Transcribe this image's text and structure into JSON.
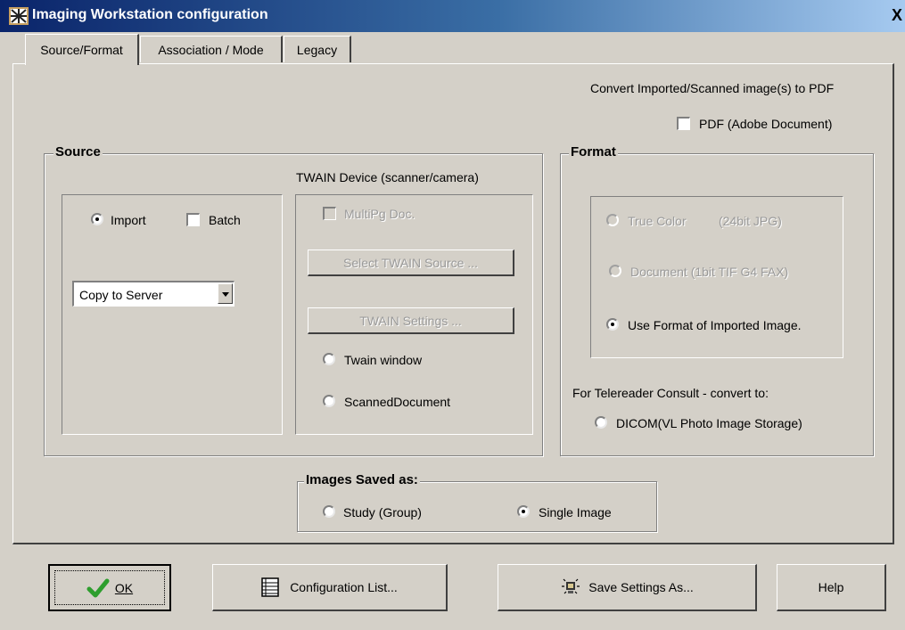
{
  "window": {
    "title": "Imaging Workstation configuration",
    "close_label": "X"
  },
  "tabs": [
    {
      "label": "Source/Format",
      "active": true
    },
    {
      "label": "Association / Mode",
      "active": false
    },
    {
      "label": "Legacy",
      "active": false
    }
  ],
  "pdf": {
    "heading": "Convert Imported/Scanned image(s) to PDF",
    "checkbox_label": "PDF (Adobe Document)",
    "checked": false
  },
  "source": {
    "legend": "Source",
    "import_label": "Import",
    "import_selected": true,
    "batch_label": "Batch",
    "batch_checked": false,
    "combo_value": "Copy to Server"
  },
  "twain": {
    "heading": "TWAIN Device (scanner/camera)",
    "multipage_label": "MultiPg Doc.",
    "select_source_label": "Select TWAIN Source ...",
    "settings_label": "TWAIN Settings ...",
    "twain_window_label": "Twain window",
    "scanned_document_label": "ScannedDocument"
  },
  "format": {
    "legend": "Format",
    "true_color_label": "True Color",
    "true_color_detail": "(24bit JPG)",
    "document_label": "Document (1bit TIF G4 FAX)",
    "use_imported_label": "Use Format of Imported Image.",
    "use_imported_selected": true,
    "telereader_heading": "For Telereader Consult - convert to:",
    "dicom_label": "DICOM(VL Photo Image Storage)"
  },
  "saved_as": {
    "legend": "Images Saved as:",
    "study_label": "Study (Group)",
    "single_label": "Single Image",
    "single_selected": true
  },
  "buttons": {
    "ok_label": "OK",
    "config_list_label": "Configuration List...",
    "save_settings_label": "Save Settings As...",
    "help_label": "Help"
  },
  "colors": {
    "title_bar": "#0a246a",
    "dialog_face": "#d4d0c8",
    "ok_check": "#2e9e2e"
  }
}
